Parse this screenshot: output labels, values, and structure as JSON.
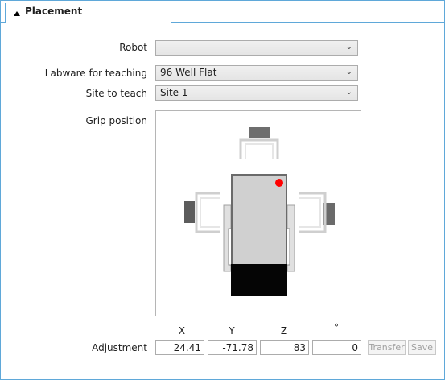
{
  "panel": {
    "title": "Placement"
  },
  "form": {
    "robot_label": "Robot",
    "robot_value": "",
    "labware_label": "Labware for teaching",
    "labware_value": "96 Well Flat",
    "site_label": "Site to teach",
    "site_value": "Site 1",
    "grip_label": "Grip position"
  },
  "adjustment": {
    "label": "Adjustment",
    "headers": [
      "X",
      "Y",
      "Z",
      "°"
    ],
    "x": "24.41",
    "y": "-71.78",
    "z": "83",
    "angle": "0",
    "transfer_label": "Transfer",
    "save_label": "Save"
  },
  "colors": {
    "accent": "#5fa8d9",
    "selected_marker": "#ff0000"
  }
}
